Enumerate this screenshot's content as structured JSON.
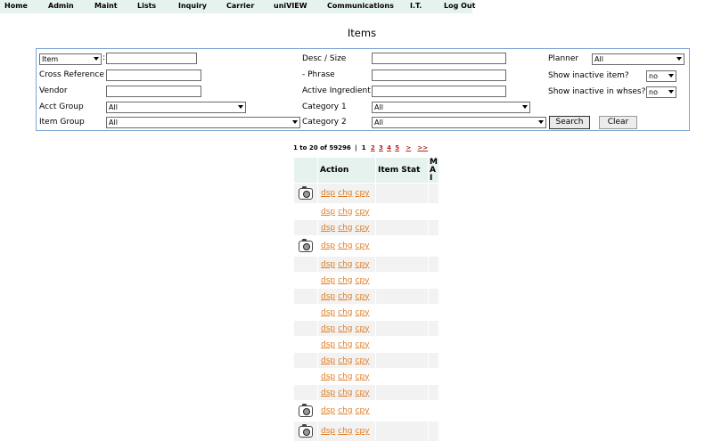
{
  "nav": [
    "Home",
    "Admin",
    "Maint",
    "Lists",
    "Inquiry",
    "Carrier",
    "uniVIEW",
    "Communications",
    "I.T.",
    "Log Out"
  ],
  "title": "Items",
  "filters": {
    "item_type_select": "Item",
    "item_colon": ":",
    "item_value": "",
    "cross_ref_label": "Cross Reference",
    "vendor_label": "Vendor",
    "acct_group_label": "Acct Group",
    "acct_group_value": "All",
    "item_group_label": "Item Group",
    "item_group_value": "All",
    "desc_label": "Desc / Size",
    "phrase_label": "- Phrase",
    "active_ingredient_label": "Active Ingredient",
    "category1_label": "Category 1",
    "category1_value": "All",
    "category2_label": "Category 2",
    "category2_value": "All",
    "planner_label": "Planner",
    "planner_value": "All",
    "show_inactive_item_label": "Show inactive item?",
    "show_inactive_item_value": "no",
    "show_inactive_whse_label": "Show inactive in whses?",
    "show_inactive_whse_value": "no",
    "search_button": "Search",
    "clear_button": "Clear"
  },
  "pager": {
    "range": "1 to 20 of 59296",
    "separator": "|",
    "current": "1",
    "pages": [
      "2",
      "3",
      "4",
      "5"
    ],
    "next": ">",
    "last": ">>"
  },
  "table": {
    "headers": {
      "action": "Action",
      "item_stat": "Item Stat",
      "mai": "M A I"
    },
    "action_links": [
      "dsp",
      "chg",
      "cpy"
    ],
    "rows_with_image": [
      0,
      3,
      13,
      14
    ],
    "row_count": 15
  }
}
